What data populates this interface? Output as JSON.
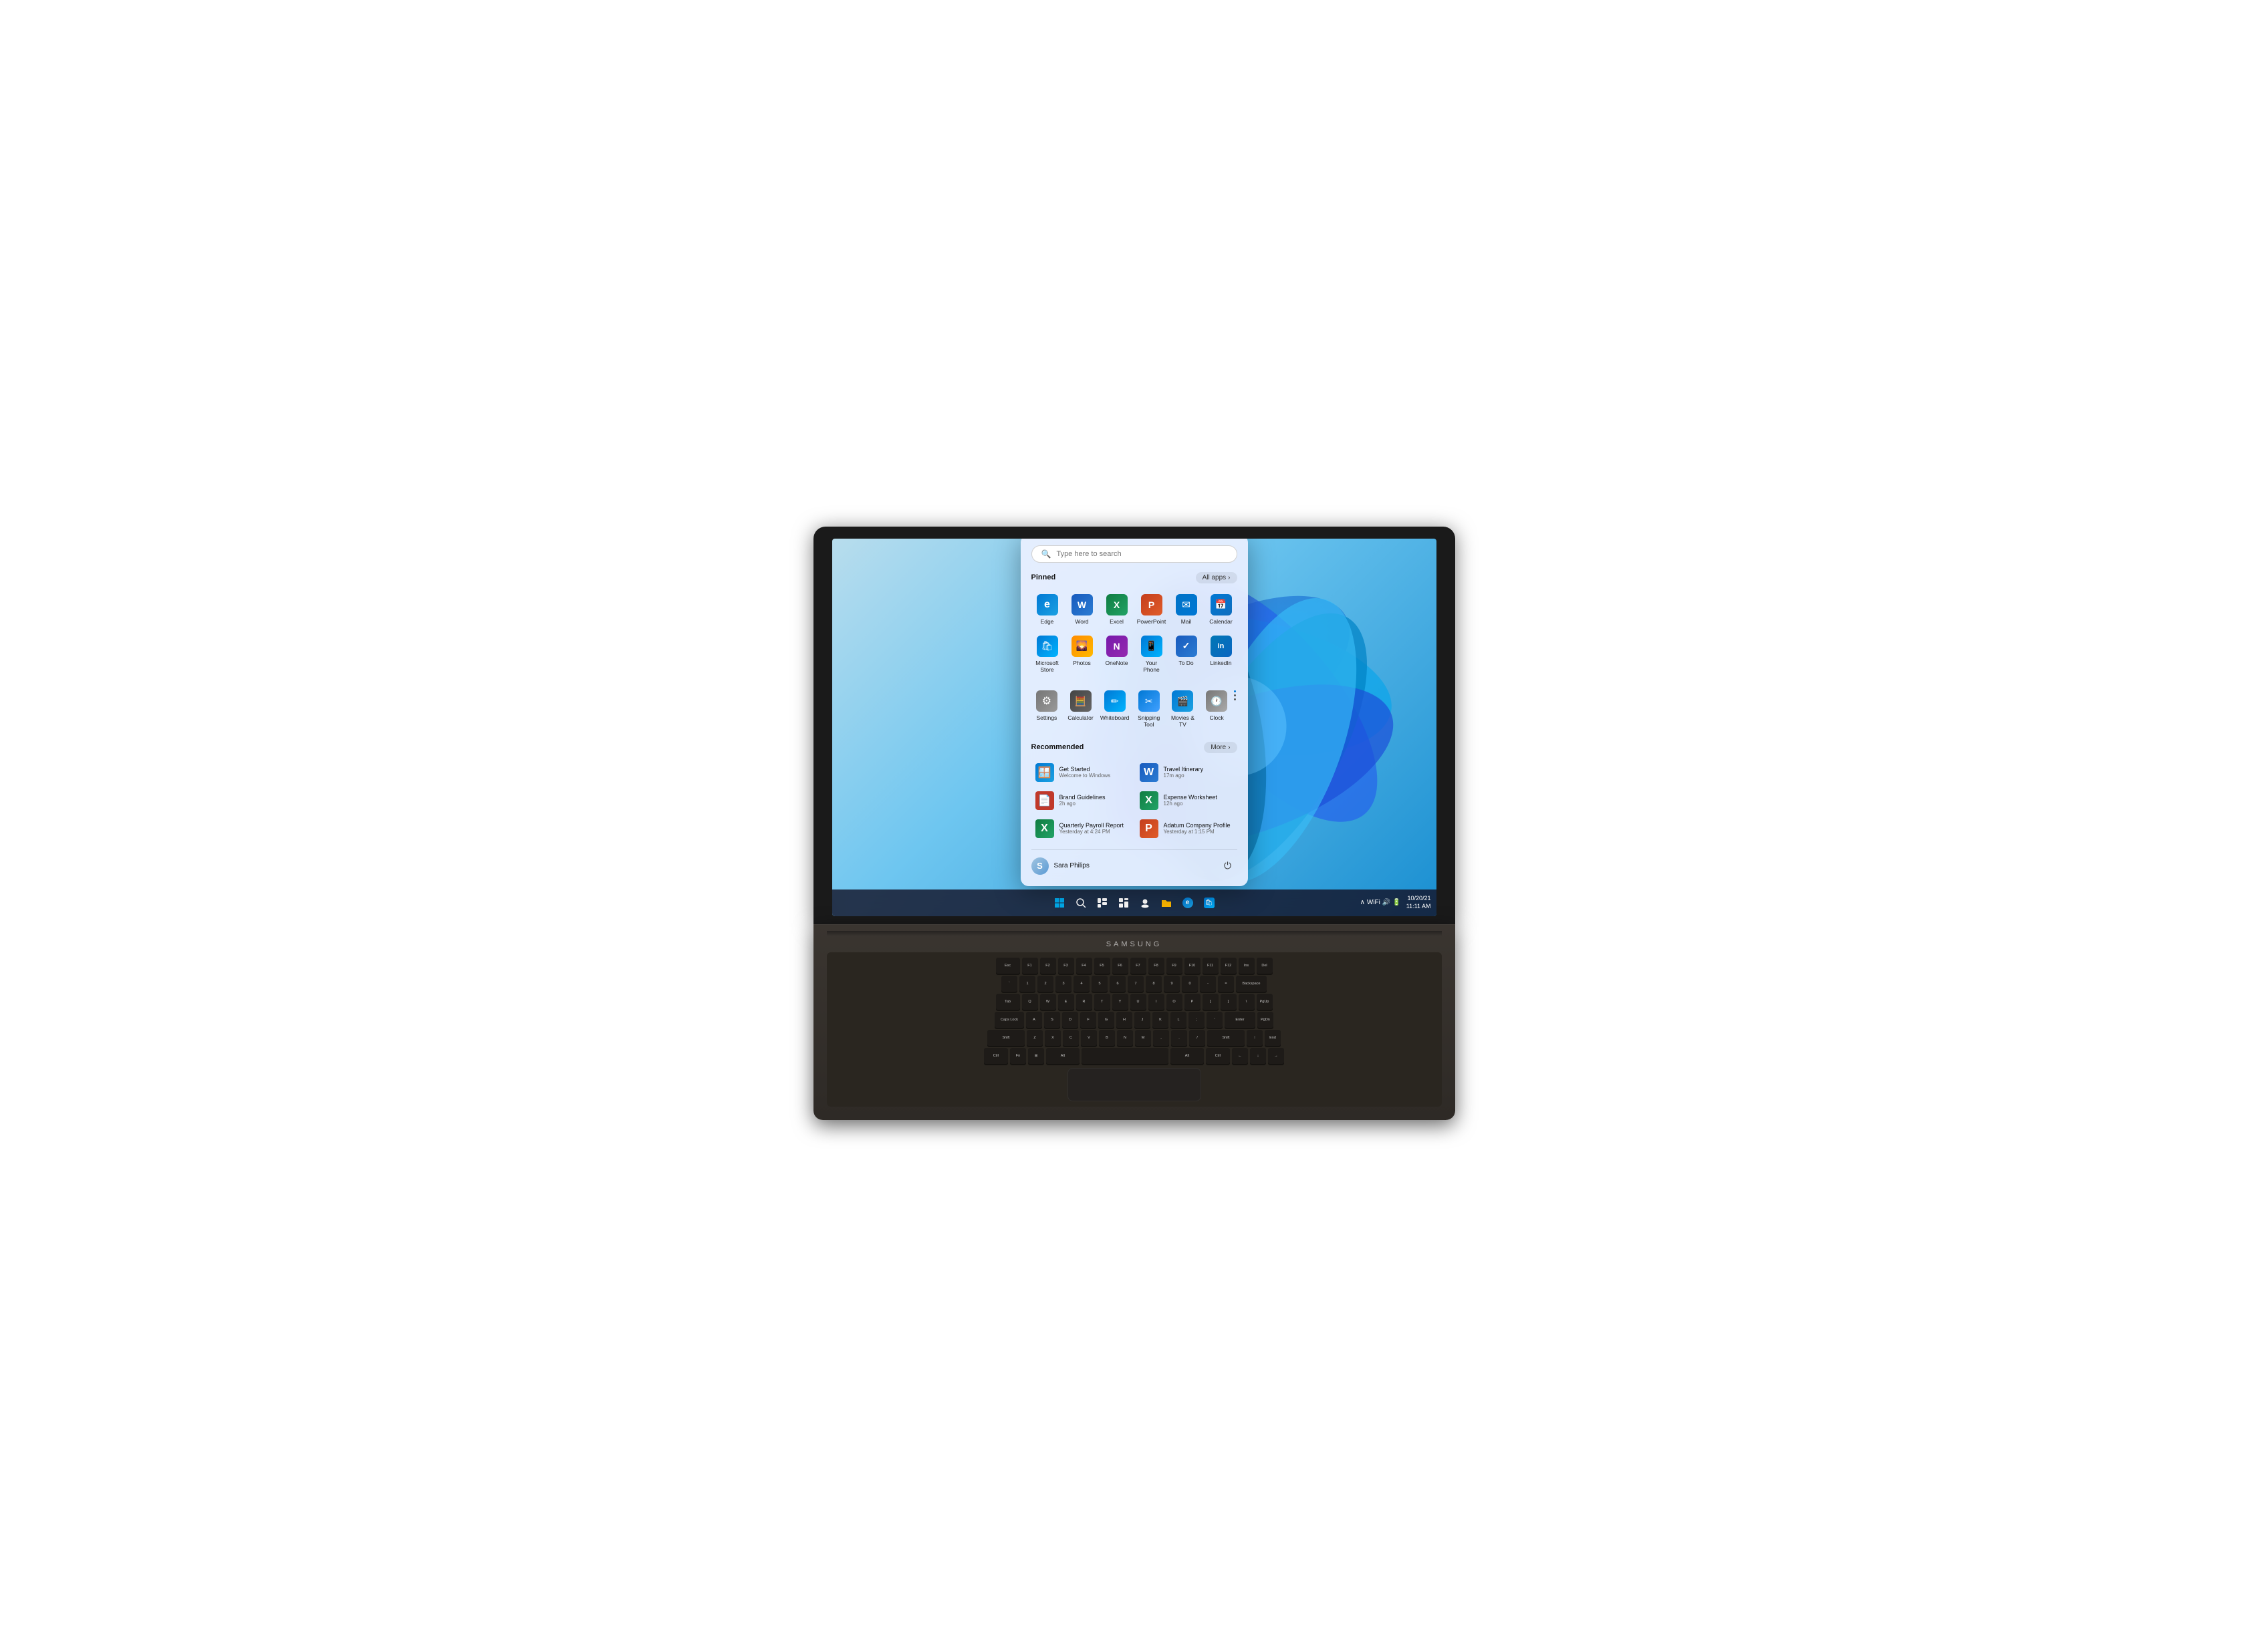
{
  "laptop": {
    "brand": "SAMSUNG"
  },
  "taskbar": {
    "clock": {
      "date": "10/20/21",
      "time": "11:11 AM"
    }
  },
  "startMenu": {
    "search": {
      "placeholder": "Type here to search"
    },
    "pinnedSection": {
      "title": "Pinned",
      "allAppsLabel": "All apps",
      "apps": [
        {
          "id": "edge",
          "label": "Edge",
          "iconClass": "icon-edge",
          "icon": "🌐"
        },
        {
          "id": "word",
          "label": "Word",
          "iconClass": "icon-word",
          "icon": "W"
        },
        {
          "id": "excel",
          "label": "Excel",
          "iconClass": "icon-excel",
          "icon": "X"
        },
        {
          "id": "powerpoint",
          "label": "PowerPoint",
          "iconClass": "icon-powerpoint",
          "icon": "P"
        },
        {
          "id": "mail",
          "label": "Mail",
          "iconClass": "icon-mail",
          "icon": "✉"
        },
        {
          "id": "calendar",
          "label": "Calendar",
          "iconClass": "icon-calendar",
          "icon": "📅"
        },
        {
          "id": "msstore",
          "label": "Microsoft Store",
          "iconClass": "icon-msstore",
          "icon": "🏪"
        },
        {
          "id": "photos",
          "label": "Photos",
          "iconClass": "icon-photos",
          "icon": "🌄"
        },
        {
          "id": "onenote",
          "label": "OneNote",
          "iconClass": "icon-onenote",
          "icon": "N"
        },
        {
          "id": "phone",
          "label": "Your Phone",
          "iconClass": "icon-phone",
          "icon": "📱"
        },
        {
          "id": "todo",
          "label": "To Do",
          "iconClass": "icon-todo",
          "icon": "✓"
        },
        {
          "id": "linkedin",
          "label": "LinkedIn",
          "iconClass": "icon-linkedin",
          "icon": "in"
        }
      ]
    },
    "pinnedRow2": {
      "apps": [
        {
          "id": "settings",
          "label": "Settings",
          "iconClass": "icon-settings",
          "icon": "⚙"
        },
        {
          "id": "calculator",
          "label": "Calculator",
          "iconClass": "icon-calc",
          "icon": "🧮"
        },
        {
          "id": "whiteboard",
          "label": "Whiteboard",
          "iconClass": "icon-whiteboard",
          "icon": "✏"
        },
        {
          "id": "snipping",
          "label": "Snipping Tool",
          "iconClass": "icon-snipping",
          "icon": "✂"
        },
        {
          "id": "movies",
          "label": "Movies & TV",
          "iconClass": "icon-movies",
          "icon": "🎬"
        },
        {
          "id": "clock",
          "label": "Clock",
          "iconClass": "icon-clock",
          "icon": "🕐"
        }
      ]
    },
    "recommendedSection": {
      "title": "Recommended",
      "moreLabel": "More",
      "items": [
        {
          "id": "get-started",
          "name": "Get Started",
          "subtitle": "Welcome to Windows",
          "iconClass": "icon-get-started",
          "icon": "🪟"
        },
        {
          "id": "travel",
          "name": "Travel Itinerary",
          "subtitle": "17m ago",
          "iconClass": "icon-travel",
          "icon": "W"
        },
        {
          "id": "brand",
          "name": "Brand Guidelines",
          "subtitle": "2h ago",
          "iconClass": "icon-brand",
          "icon": "📄"
        },
        {
          "id": "expense",
          "name": "Expense Worksheet",
          "subtitle": "12h ago",
          "iconClass": "icon-expense",
          "icon": "X"
        },
        {
          "id": "payroll",
          "name": "Quarterly Payroll Report",
          "subtitle": "Yesterday at 4:24 PM",
          "iconClass": "icon-payroll",
          "icon": "X"
        },
        {
          "id": "adatum",
          "name": "Adatum Company Profile",
          "subtitle": "Yesterday at 1:15 PM",
          "iconClass": "icon-adatum",
          "icon": "P"
        }
      ]
    },
    "footer": {
      "userName": "Sara Philips",
      "powerIcon": "⏻"
    }
  }
}
